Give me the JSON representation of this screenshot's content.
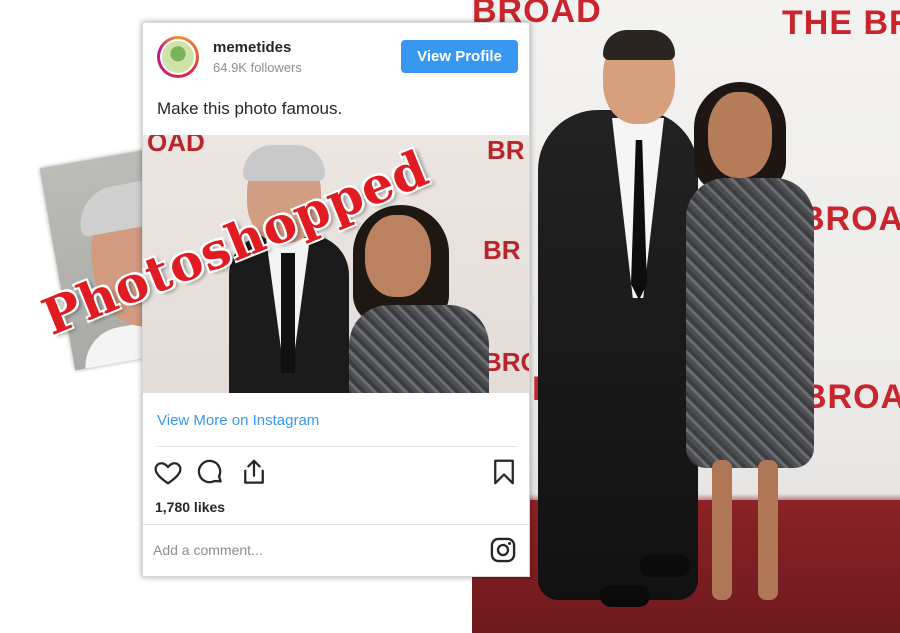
{
  "post": {
    "username": "memetides",
    "followers": "64.9K followers",
    "view_profile_label": "View Profile",
    "caption": "Make this photo famous.",
    "view_more_label": "View More on Instagram",
    "likes": "1,780 likes",
    "comment_placeholder": "Add a comment..."
  },
  "overlay": {
    "stamp_text": "Photoshopped"
  },
  "backdrop": {
    "wall_text_top_partial": "BROAD",
    "wall_text_top_right": "THE BROAD",
    "wall_text_mid": "BROAD",
    "wall_text_mid_partial": "THE BROAD",
    "wall_text_low": "BROAD"
  },
  "post_image": {
    "wall_text_a": "OAD",
    "wall_text_b": "BR",
    "wall_text_c": "BR",
    "wall_text_d": "BRO"
  },
  "icons": [
    "heart-icon",
    "comment-icon",
    "share-icon",
    "bookmark-icon",
    "instagram-icon"
  ],
  "colors": {
    "accent_blue": "#3897f0",
    "stamp_red": "#e01b22",
    "wall_red": "#c8262c"
  }
}
